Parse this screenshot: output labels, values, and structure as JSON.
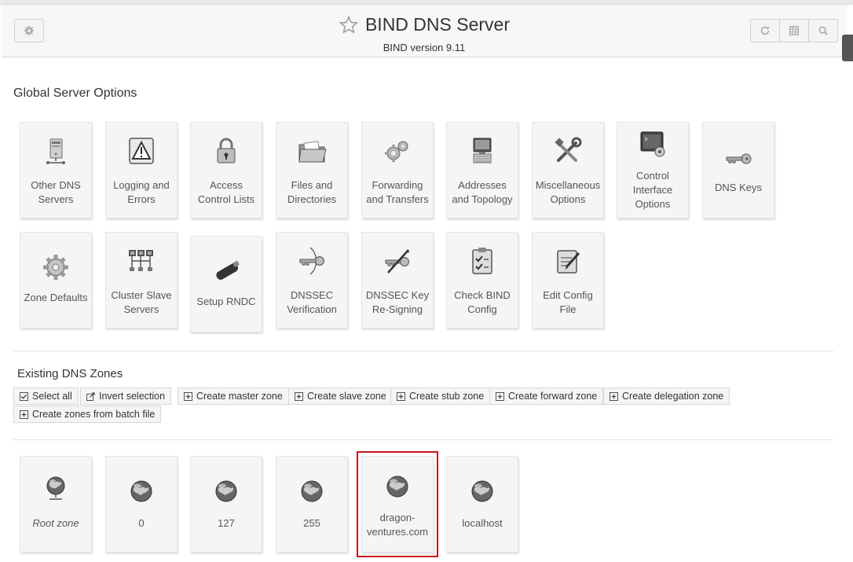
{
  "header": {
    "title": "BIND DNS Server",
    "subtitle": "BIND version 9.11",
    "icons": [
      "gear-icon",
      "star-icon",
      "refresh-icon",
      "grid-icon",
      "search-icon"
    ]
  },
  "global": {
    "heading": "Global Server Options",
    "row1": [
      {
        "label": "Other DNS Servers",
        "icon": "server-icon"
      },
      {
        "label": "Logging and Errors",
        "icon": "warning-icon"
      },
      {
        "label": "Access Control Lists",
        "icon": "padlock-icon"
      },
      {
        "label": "Files and Directories",
        "icon": "folder-icon"
      },
      {
        "label": "Forwarding and Transfers",
        "icon": "gears-icon"
      },
      {
        "label": "Addresses and Topology",
        "icon": "computer-icon"
      },
      {
        "label": "Miscellaneous Options",
        "icon": "tools-icon"
      },
      {
        "label": "Control Interface Options",
        "icon": "terminal-icon"
      },
      {
        "label": "DNS Keys",
        "icon": "key-icon"
      }
    ],
    "row2": [
      {
        "label": "Zone Defaults",
        "icon": "cog-icon"
      },
      {
        "label": "Cluster Slave Servers",
        "icon": "network-icon"
      },
      {
        "label": "Setup RNDC",
        "icon": "usb-icon"
      },
      {
        "label": "DNSSEC Verification",
        "icon": "key-verify-icon"
      },
      {
        "label": "DNSSEC Key Re-Signing",
        "icon": "key-sign-icon"
      },
      {
        "label": "Check BIND Config",
        "icon": "checklist-icon"
      },
      {
        "label": "Edit Config File",
        "icon": "edit-icon"
      }
    ]
  },
  "zones": {
    "heading": "Existing DNS Zones",
    "buttons": [
      {
        "label": "Select all",
        "icon": "checkbox-icon"
      },
      {
        "label": "Invert selection",
        "icon": "invert-icon"
      },
      {
        "label": "Create master zone",
        "icon": "plus-box-icon"
      },
      {
        "label": "Create slave zone",
        "icon": "plus-box-icon"
      },
      {
        "label": "Create stub zone",
        "icon": "plus-box-icon"
      },
      {
        "label": "Create forward zone",
        "icon": "plus-box-icon"
      },
      {
        "label": "Create delegation zone",
        "icon": "plus-box-icon"
      },
      {
        "label": "Create zones from batch file",
        "icon": "plus-box-icon"
      }
    ],
    "items": [
      {
        "label": "Root zone",
        "icon": "globe-network-icon"
      },
      {
        "label": "0",
        "icon": "globe-icon"
      },
      {
        "label": "127",
        "icon": "globe-icon"
      },
      {
        "label": "255",
        "icon": "globe-icon"
      },
      {
        "label": "dragon-ventures.com",
        "icon": "globe-icon"
      },
      {
        "label": "localhost",
        "icon": "globe-icon"
      }
    ]
  },
  "colors": {
    "highlight": "#c8171d",
    "tile": "#f5f5f5"
  }
}
